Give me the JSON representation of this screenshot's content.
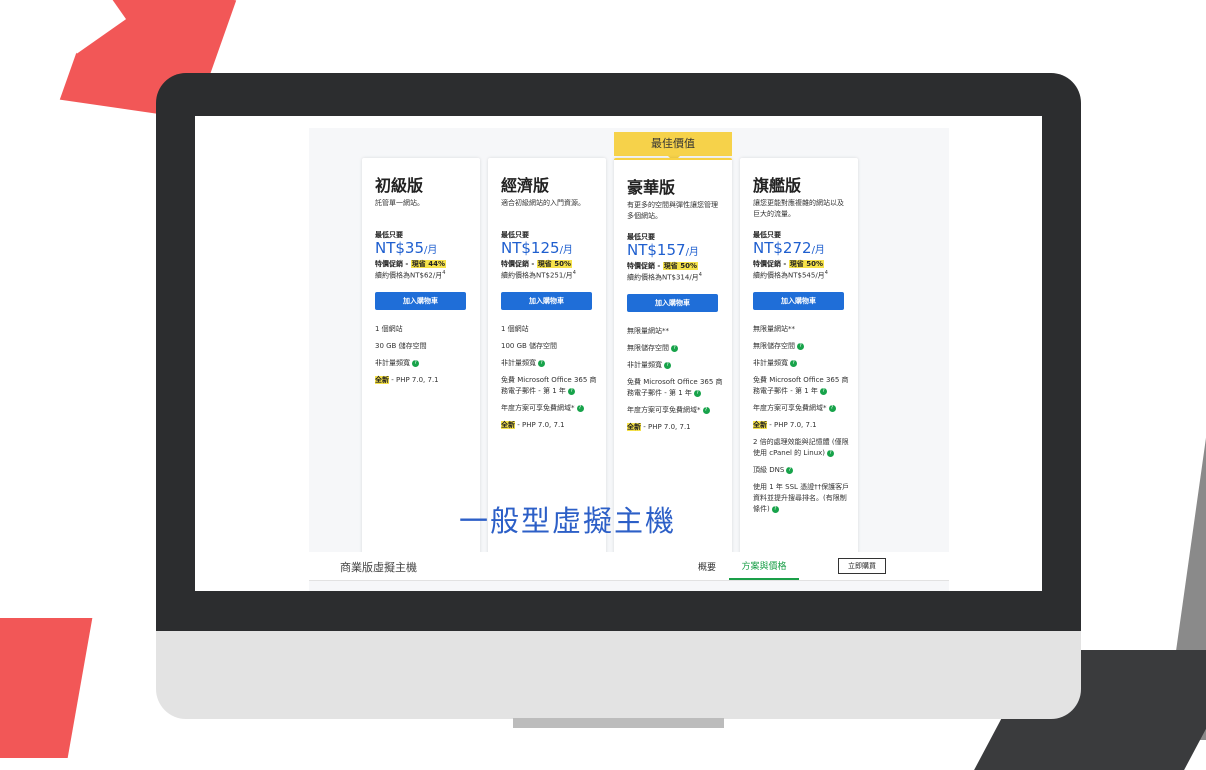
{
  "badge": "最佳價值",
  "plans": [
    {
      "name": "初級版",
      "desc": "託管單一網站。",
      "from_label": "最低只要",
      "price": "NT$35",
      "per": "/月",
      "promo_prefix": "特價促銷 - ",
      "promo_save": "現省 44%",
      "renew": "續約價格為NT$62/月",
      "renew_sup": "4",
      "cart_label": "加入購物車",
      "features": [
        "1 個網站",
        "30 GB 儲存空間",
        "非計量頻寬",
        "全新 - PHP 7.0, 7.1"
      ]
    },
    {
      "name": "經濟版",
      "desc": "適合初級網站的入門資源。",
      "from_label": "最低只要",
      "price": "NT$125",
      "per": "/月",
      "promo_prefix": "特價促銷 - ",
      "promo_save": "現省 50%",
      "renew": "續約價格為NT$251/月",
      "renew_sup": "4",
      "cart_label": "加入購物車",
      "features": [
        "1 個網站",
        "100 GB 儲存空間",
        "非計量頻寬",
        "免費 Microsoft Office 365 商務電子郵件 - 第 1 年",
        "年度方案可享免費網域*",
        "全新 - PHP 7.0, 7.1"
      ]
    },
    {
      "name": "豪華版",
      "desc": "有更多的空間與彈性讓您管理多個網站。",
      "from_label": "最低只要",
      "price": "NT$157",
      "per": "/月",
      "promo_prefix": "特價促銷 - ",
      "promo_save": "現省 50%",
      "renew": "續約價格為NT$314/月",
      "renew_sup": "4",
      "cart_label": "加入購物車",
      "features": [
        "無限量網站**",
        "無限儲存空間",
        "非計量頻寬",
        "免費 Microsoft Office 365 商務電子郵件 - 第 1 年",
        "年度方案可享免費網域*",
        "全新 - PHP 7.0, 7.1"
      ]
    },
    {
      "name": "旗艦版",
      "desc": "讓您更能對應複雜的網站以及巨大的流量。",
      "from_label": "最低只要",
      "price": "NT$272",
      "per": "/月",
      "promo_prefix": "特價促銷 - ",
      "promo_save": "現省 50%",
      "renew": "續約價格為NT$545/月",
      "renew_sup": "4",
      "cart_label": "加入購物車",
      "features": [
        "無限量網站**",
        "無限儲存空間",
        "非計量頻寬",
        "免費 Microsoft Office 365 商務電子郵件 - 第 1 年",
        "年度方案可享免費網域*",
        "全新 - PHP 7.0, 7.1",
        "2 倍的處理效能與記憶體 (僅限使用 cPanel 的 Linux)",
        "頂級 DNS",
        "使用 1 年 SSL 憑證††保護客戶資料並提升搜尋排名。(有限制條件)"
      ]
    }
  ],
  "overlay_title": "一般型虛擬主機",
  "subnav": {
    "title": "商業版虛擬主機",
    "overview": "概要",
    "plans": "方案與價格",
    "buy_now": "立即購買"
  }
}
